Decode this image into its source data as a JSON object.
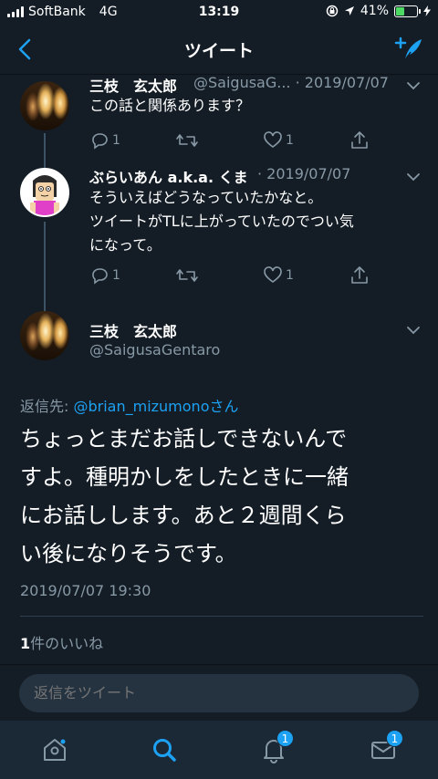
{
  "status_bar": {
    "carrier": "SoftBank",
    "network": "4G",
    "time": "13:19",
    "battery": "41%",
    "battery_level": 0.41
  },
  "nav": {
    "title": "ツイート",
    "back_icon": "chevron-left-icon",
    "compose_icon": "compose-tweet-icon"
  },
  "tweets": [
    {
      "name": "三枝　玄太郎",
      "handle_date": "@SaigusaG... · 2019/07/07",
      "text": [
        "この話と関係あります？"
      ],
      "reply_count": "1",
      "like_count": "1"
    },
    {
      "name": "ぶらいあん a.k.a. くま",
      "handle_date": "· 2019/07/07",
      "text": [
        "そういえばどうなっていたかなと。",
        "ツイートがTLに上がっていたのでつい気",
        "になって。"
      ],
      "reply_count": "1",
      "like_count": "1"
    }
  ],
  "main_tweet": {
    "name": "三枝　玄太郎",
    "handle": "@SaigusaGentaro",
    "reply_to_prefix": "返信先: ",
    "reply_to_handle": "@brian_mizumono",
    "reply_to_suffix": "さん",
    "text_lines": [
      "ちょっとまだお話しできないんで",
      "すよ。種明かしをしたときに一緒",
      "にお話しします。あと２週間くら",
      "い後になりそうです。"
    ],
    "timestamp": "2019/07/07 19:30",
    "like_count": "1",
    "like_label": "件のいいね"
  },
  "reply_bar": {
    "placeholder": "返信をツイート"
  },
  "tab_bar": {
    "notifications_badge": "1",
    "messages_badge": "1"
  },
  "colors": {
    "background": "#141d26",
    "accent": "#1da1f2",
    "secondary_text": "#8899a6"
  }
}
